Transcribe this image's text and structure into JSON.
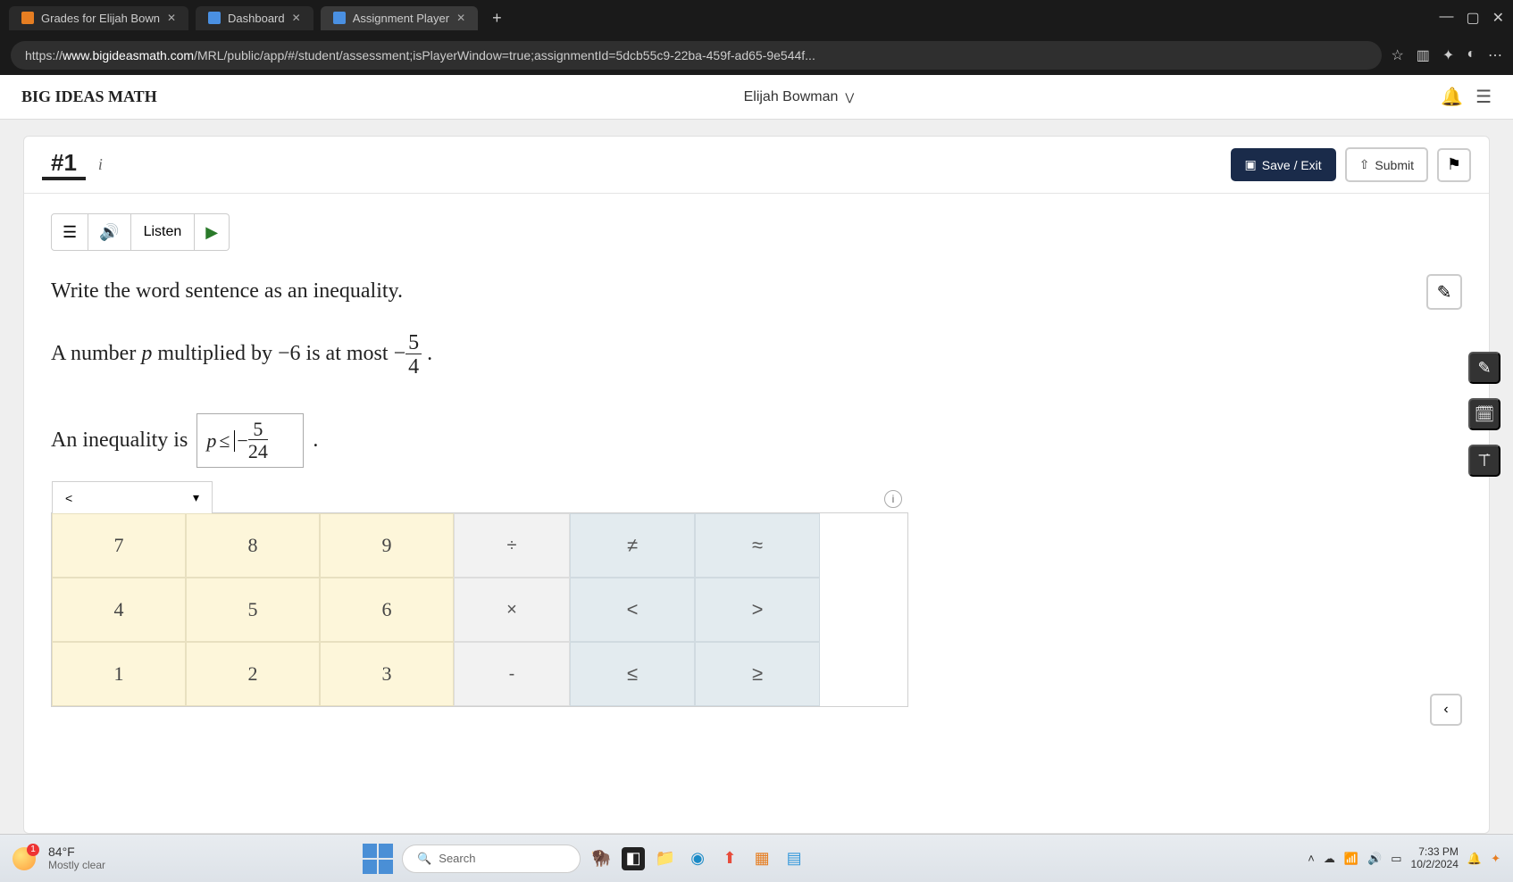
{
  "browser": {
    "tabs": [
      {
        "title": "Grades for Elijah Bown",
        "icon": "orange"
      },
      {
        "title": "Dashboard",
        "icon": "blue"
      },
      {
        "title": "Assignment Player",
        "icon": "blue",
        "active": true
      }
    ],
    "url_prefix": "https://",
    "url_domain": "www.bigideasmath.com",
    "url_path": "/MRL/public/app/#/student/assessment;isPlayerWindow=true;assignmentId=5dcb55c9-22ba-459f-ad65-9e544f..."
  },
  "header": {
    "brand": "BIG IDEAS MATH",
    "user": "Elijah Bowman"
  },
  "question": {
    "number": "#1",
    "listen_label": "Listen",
    "save_label": "Save / Exit",
    "submit_label": "Submit",
    "prompt_line1": "Write the word sentence as an inequality.",
    "prompt_line2_a": "A number ",
    "prompt_var": "p",
    "prompt_line2_b": " multiplied by ",
    "prompt_num": "−6",
    "prompt_line2_c": " is at most ",
    "prompt_frac_sign": "−",
    "prompt_frac_num": "5",
    "prompt_frac_den": "4",
    "answer_prefix": "An inequality is ",
    "answer_var": "p",
    "answer_rel": "≤",
    "answer_sign": "−",
    "answer_frac_num": "5",
    "answer_frac_den": "24"
  },
  "keypad": {
    "tab_label": "<",
    "numbers": [
      "7",
      "8",
      "9",
      "4",
      "5",
      "6",
      "1",
      "2",
      "3"
    ],
    "ops": [
      "÷",
      "×",
      "-"
    ],
    "rels": [
      "≠",
      "≈",
      "<",
      ">",
      "≤",
      "≥"
    ]
  },
  "taskbar": {
    "temp": "84°F",
    "condition": "Mostly clear",
    "search_placeholder": "Search",
    "time": "7:33 PM",
    "date": "10/2/2024"
  }
}
